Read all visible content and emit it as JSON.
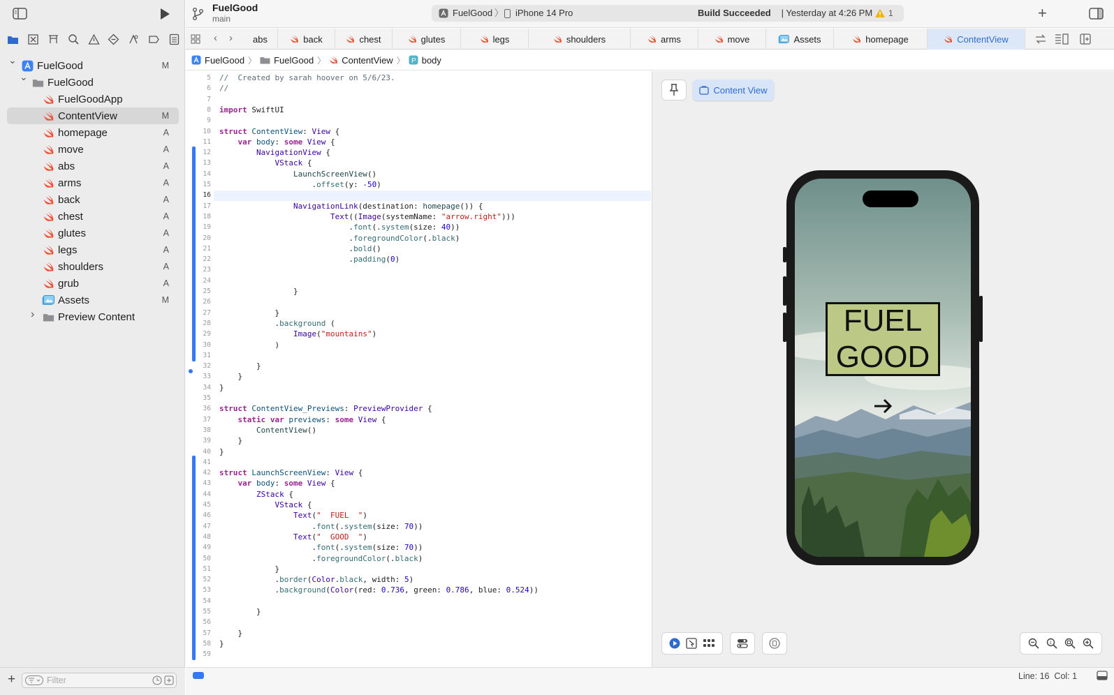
{
  "project": {
    "name": "FuelGood",
    "branch": "main"
  },
  "activity": {
    "app": "FuelGood",
    "device": "iPhone 14 Pro",
    "status_bold": "Build Succeeded",
    "status_rest": " | Yesterday at 4:26 PM",
    "warnings": "1"
  },
  "tabs": [
    {
      "label": "abs"
    },
    {
      "label": "back"
    },
    {
      "label": "chest"
    },
    {
      "label": "glutes"
    },
    {
      "label": "legs"
    },
    {
      "label": "shoulders"
    },
    {
      "label": "arms"
    },
    {
      "label": "move"
    },
    {
      "label": "Assets"
    },
    {
      "label": "homepage"
    },
    {
      "label": "ContentView"
    }
  ],
  "breadcrumb": [
    "FuelGood",
    "FuelGood",
    "ContentView",
    "body"
  ],
  "tree": [
    {
      "label": "FuelGood",
      "status": "M"
    },
    {
      "label": "FuelGood",
      "status": ""
    },
    {
      "label": "FuelGoodApp",
      "status": ""
    },
    {
      "label": "ContentView",
      "status": "M"
    },
    {
      "label": "homepage",
      "status": "A"
    },
    {
      "label": "move",
      "status": "A"
    },
    {
      "label": "abs",
      "status": "A"
    },
    {
      "label": "arms",
      "status": "A"
    },
    {
      "label": "back",
      "status": "A"
    },
    {
      "label": "chest",
      "status": "A"
    },
    {
      "label": "glutes",
      "status": "A"
    },
    {
      "label": "legs",
      "status": "A"
    },
    {
      "label": "shoulders",
      "status": "A"
    },
    {
      "label": "grub",
      "status": "A"
    },
    {
      "label": "Assets",
      "status": "M"
    },
    {
      "label": "Preview Content",
      "status": ""
    }
  ],
  "filter_placeholder": "Filter",
  "code_lines": [
    {
      "n": "5",
      "html": "<span class='cm'>//  Created by sarah hoover on 5/6/23.</span>"
    },
    {
      "n": "6",
      "html": "<span class='cm'>//</span>"
    },
    {
      "n": "7",
      "html": ""
    },
    {
      "n": "8",
      "html": "<span class='kw'>import</span> SwiftUI"
    },
    {
      "n": "9",
      "html": ""
    },
    {
      "n": "10",
      "html": "<span class='kw'>struct</span> <span class='ty'>ContentView</span>: <span class='ty3'>View</span> {"
    },
    {
      "n": "11",
      "html": "    <span class='kw'>var</span> <span class='ty'>body</span>: <span class='kw'>some</span> <span class='ty3'>View</span> {"
    },
    {
      "n": "12",
      "html": "        <span class='ty3'>NavigationView</span> {"
    },
    {
      "n": "13",
      "html": "            <span class='ty3'>VStack</span> {"
    },
    {
      "n": "14",
      "html": "                <span class='ty2'>LaunchScreenView</span>()"
    },
    {
      "n": "15",
      "html": "                    .<span class='fn'>offset</span>(y: <span class='num'>-50</span>)"
    },
    {
      "n": "16",
      "html": ""
    },
    {
      "n": "17",
      "html": "                <span class='ty3'>NavigationLink</span>(destination: <span class='ty2'>homepage</span>()) {"
    },
    {
      "n": "18",
      "html": "                        <span class='ty3'>Text</span>((<span class='ty3'>Image</span>(systemName: <span class='str'>\"arrow.right\"</span>)))"
    },
    {
      "n": "19",
      "html": "                            .<span class='fn'>font</span>(.<span class='fn'>system</span>(size: <span class='num'>40</span>))"
    },
    {
      "n": "20",
      "html": "                            .<span class='fn'>foregroundColor</span>(.<span class='fn'>black</span>)"
    },
    {
      "n": "21",
      "html": "                            .<span class='fn'>bold</span>()"
    },
    {
      "n": "22",
      "html": "                            .<span class='fn'>padding</span>(<span class='num'>0</span>)"
    },
    {
      "n": "23",
      "html": ""
    },
    {
      "n": "24",
      "html": ""
    },
    {
      "n": "25",
      "html": "                }"
    },
    {
      "n": "26",
      "html": ""
    },
    {
      "n": "27",
      "html": "            }"
    },
    {
      "n": "28",
      "html": "            .<span class='fn'>background</span> ("
    },
    {
      "n": "29",
      "html": "                <span class='ty3'>Image</span>(<span class='str'>\"mountains\"</span>)"
    },
    {
      "n": "30",
      "html": "            )"
    },
    {
      "n": "31",
      "html": ""
    },
    {
      "n": "32",
      "html": "        }"
    },
    {
      "n": "33",
      "html": "    }"
    },
    {
      "n": "34",
      "html": "}"
    },
    {
      "n": "35",
      "html": ""
    },
    {
      "n": "36",
      "html": "<span class='kw'>struct</span> <span class='ty'>ContentView_Previews</span>: <span class='ty3'>PreviewProvider</span> {"
    },
    {
      "n": "37",
      "html": "    <span class='kw'>static</span> <span class='kw'>var</span> <span class='ty'>previews</span>: <span class='kw'>some</span> <span class='ty3'>View</span> {"
    },
    {
      "n": "38",
      "html": "        <span class='ty2'>ContentView</span>()"
    },
    {
      "n": "39",
      "html": "    }"
    },
    {
      "n": "40",
      "html": "}"
    },
    {
      "n": "41",
      "html": ""
    },
    {
      "n": "42",
      "html": "<span class='kw'>struct</span> <span class='ty'>LaunchScreenView</span>: <span class='ty3'>View</span> {"
    },
    {
      "n": "43",
      "html": "    <span class='kw'>var</span> <span class='ty'>body</span>: <span class='kw'>some</span> <span class='ty3'>View</span> {"
    },
    {
      "n": "44",
      "html": "        <span class='ty3'>ZStack</span> {"
    },
    {
      "n": "45",
      "html": "            <span class='ty3'>VStack</span> {"
    },
    {
      "n": "46",
      "html": "                <span class='ty3'>Text</span>(<span class='str'>\"  FUEL  \"</span>)"
    },
    {
      "n": "47",
      "html": "                    .<span class='fn'>font</span>(.<span class='fn'>system</span>(size: <span class='num'>70</span>))"
    },
    {
      "n": "48",
      "html": "                <span class='ty3'>Text</span>(<span class='str'>\"  GOOD  \"</span>)"
    },
    {
      "n": "49",
      "html": "                    .<span class='fn'>font</span>(.<span class='fn'>system</span>(size: <span class='num'>70</span>))"
    },
    {
      "n": "50",
      "html": "                    .<span class='fn'>foregroundColor</span>(.<span class='fn'>black</span>)"
    },
    {
      "n": "51",
      "html": "            }"
    },
    {
      "n": "52",
      "html": "            .<span class='fn'>border</span>(<span class='ty3'>Color</span>.<span class='fn'>black</span>, width: <span class='num'>5</span>)"
    },
    {
      "n": "53",
      "html": "            .<span class='fn'>background</span>(<span class='ty3'>Color</span>(red: <span class='num'>0.736</span>, green: <span class='num'>0.786</span>, blue: <span class='num'>0.524</span>))"
    },
    {
      "n": "54",
      "html": ""
    },
    {
      "n": "55",
      "html": "        }"
    },
    {
      "n": "56",
      "html": ""
    },
    {
      "n": "57",
      "html": "    }"
    },
    {
      "n": "58",
      "html": "}"
    },
    {
      "n": "59",
      "html": ""
    }
  ],
  "preview": {
    "canvas_label": "Content View",
    "line1": "FUEL",
    "line2": "GOOD"
  },
  "status": {
    "position": "Line: 16  Col: 1"
  },
  "colors": {
    "accent": "#2f6bcf",
    "swift_orange": "#f05138",
    "fuel_box": "#bcc986"
  }
}
